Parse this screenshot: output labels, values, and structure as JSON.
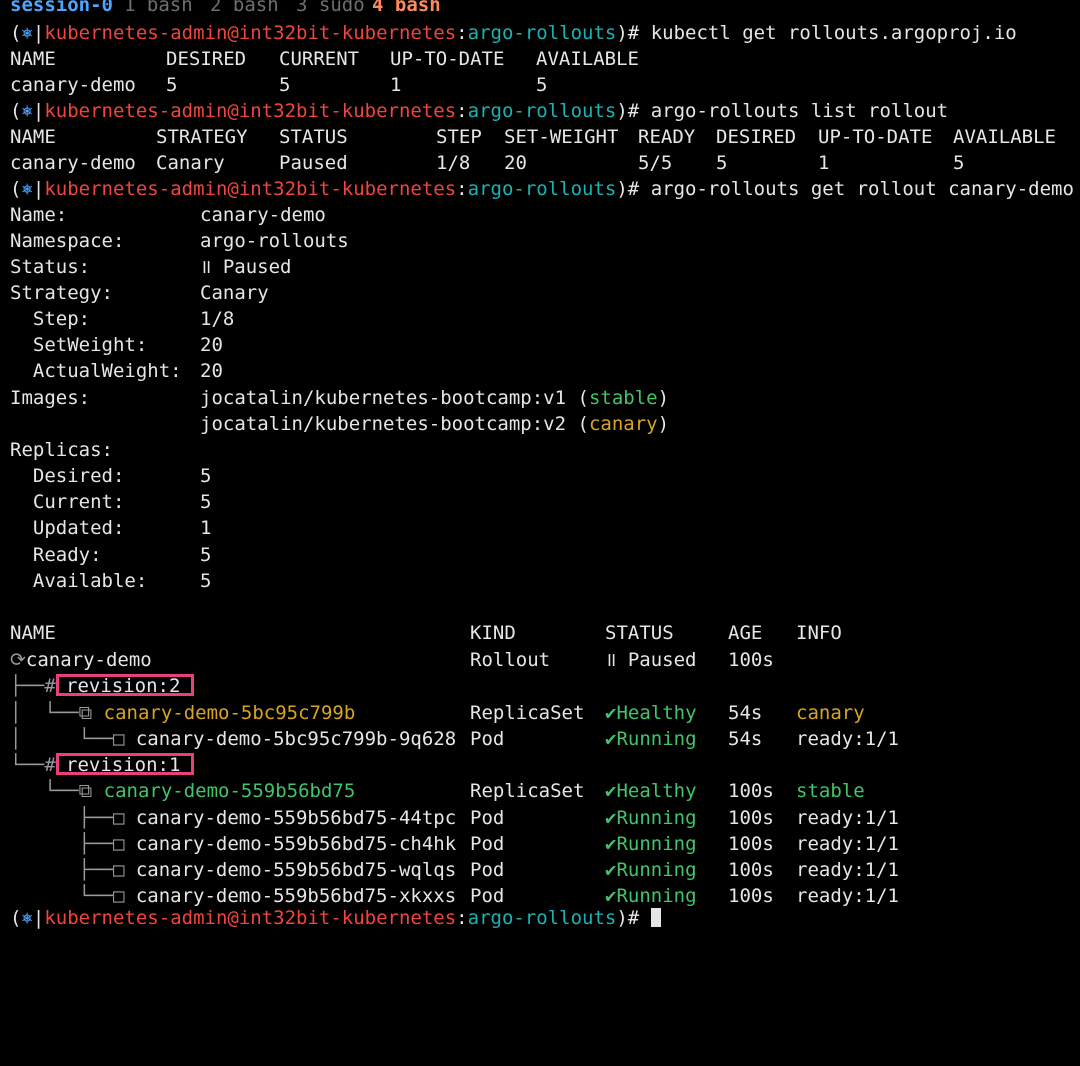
{
  "tmux": {
    "session": "session-0",
    "windows": [
      {
        "label": "1 bash",
        "active": false
      },
      {
        "label": "2 bash",
        "active": false
      },
      {
        "label": "3 sudo",
        "active": false
      },
      {
        "label": "4 bash",
        "active": true
      }
    ]
  },
  "prompt": {
    "open": "(",
    "icon": "⎈",
    "sep": "|",
    "user": "kubernetes-admin@int32bit-kubernetes",
    "colon": ":",
    "namespace": "argo-rollouts",
    "close": ")#"
  },
  "commands": [
    "kubectl get rollouts.argoproj.io",
    "argo-rollouts list rollout",
    "argo-rollouts get rollout canary-demo"
  ],
  "kubectl_table": {
    "headers": [
      "NAME",
      "DESIRED",
      "CURRENT",
      "UP-TO-DATE",
      "AVAILABLE"
    ],
    "rows": [
      [
        "canary-demo",
        "5",
        "5",
        "1",
        "5"
      ]
    ]
  },
  "list_table": {
    "headers": [
      "NAME",
      "STRATEGY",
      "STATUS",
      "STEP",
      "SET-WEIGHT",
      "READY",
      "DESIRED",
      "UP-TO-DATE",
      "AVAILABLE"
    ],
    "rows": [
      [
        "canary-demo",
        "Canary",
        "Paused",
        "1/8",
        "20",
        "5/5",
        "5",
        "1",
        "5"
      ]
    ]
  },
  "details": {
    "name": {
      "label": "Name:",
      "value": "canary-demo"
    },
    "namespace": {
      "label": "Namespace:",
      "value": "argo-rollouts"
    },
    "status": {
      "label": "Status:",
      "value": "॥ Paused"
    },
    "strategy": {
      "label": "Strategy:",
      "value": "Canary"
    },
    "step": {
      "label": "  Step:",
      "value": "1/8"
    },
    "setweight": {
      "label": "  SetWeight:",
      "value": "20"
    },
    "actualweight": {
      "label": "  ActualWeight:",
      "value": "20"
    },
    "images_label": "Images:",
    "images": [
      {
        "image": "jocatalin/kubernetes-bootcamp:v1",
        "tag": "stable"
      },
      {
        "image": "jocatalin/kubernetes-bootcamp:v2",
        "tag": "canary"
      }
    ],
    "replicas_label": "Replicas:",
    "replicas": [
      {
        "label": "  Desired:",
        "value": "5"
      },
      {
        "label": "  Current:",
        "value": "5"
      },
      {
        "label": "  Updated:",
        "value": "1"
      },
      {
        "label": "  Ready:",
        "value": "5"
      },
      {
        "label": "  Available:",
        "value": "5"
      }
    ]
  },
  "tree": {
    "headers": [
      "NAME",
      "KIND",
      "STATUS",
      "AGE",
      "INFO"
    ],
    "root": {
      "prefix": "⟳",
      "name": "canary-demo",
      "kind": "Rollout",
      "status": "॥ Paused",
      "age": "100s",
      "info": ""
    },
    "revisions": [
      {
        "prefix": "├──# ",
        "label": "revision:2",
        "replicaset": {
          "prefix": "│  └──⧉ ",
          "name": "canary-demo-5bc95c799b",
          "kind": "ReplicaSet",
          "status": "✔Healthy",
          "age": "54s",
          "info": "canary"
        },
        "pods": [
          {
            "prefix": "│     └──□ ",
            "name": "canary-demo-5bc95c799b-9q628",
            "kind": "Pod",
            "status": "✔Running",
            "age": "54s",
            "info": "ready:1/1"
          }
        ]
      },
      {
        "prefix": "└──# ",
        "label": "revision:1",
        "replicaset": {
          "prefix": "   └──⧉ ",
          "name": "canary-demo-559b56bd75",
          "kind": "ReplicaSet",
          "status": "✔Healthy",
          "age": "100s",
          "info": "stable"
        },
        "pods": [
          {
            "prefix": "      ├──□ ",
            "name": "canary-demo-559b56bd75-44tpc",
            "kind": "Pod",
            "status": "✔Running",
            "age": "100s",
            "info": "ready:1/1"
          },
          {
            "prefix": "      ├──□ ",
            "name": "canary-demo-559b56bd75-ch4hk",
            "kind": "Pod",
            "status": "✔Running",
            "age": "100s",
            "info": "ready:1/1"
          },
          {
            "prefix": "      ├──□ ",
            "name": "canary-demo-559b56bd75-wqlqs",
            "kind": "Pod",
            "status": "✔Running",
            "age": "100s",
            "info": "ready:1/1"
          },
          {
            "prefix": "      └──□ ",
            "name": "canary-demo-559b56bd75-xkxxs",
            "kind": "Pod",
            "status": "✔Running",
            "age": "100s",
            "info": "ready:1/1"
          }
        ]
      }
    ]
  },
  "colors": {
    "background": "#000000",
    "text": "#e6e6e6",
    "prompt_user": "#f0443c",
    "prompt_namespace": "#19b3b3",
    "prompt_icon": "#4fa6ff",
    "stable": "#41c46a",
    "canary": "#d8a522",
    "highlight": "#ea3f7e"
  }
}
